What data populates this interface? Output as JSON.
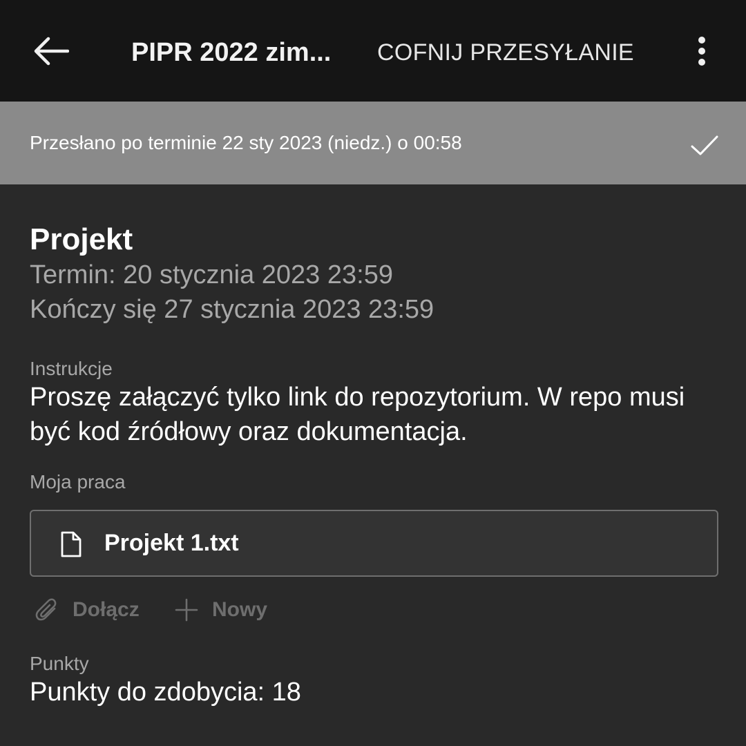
{
  "header": {
    "title": "PIPR 2022 zim...",
    "unsubmit_label": "COFNIJ PRZESYŁANIE",
    "back_icon": "arrow-left-icon",
    "more_icon": "more-vertical-icon"
  },
  "status": {
    "text": "Przesłano po terminie 22 sty 2023 (niedz.) o 00:58",
    "icon": "checkmark-icon"
  },
  "assignment": {
    "title": "Projekt",
    "due": "Termin: 20 stycznia 2023 23:59",
    "closes": "Kończy się 27 stycznia 2023 23:59"
  },
  "instructions": {
    "label": "Instrukcje",
    "text": "Proszę załączyć tylko link do repozytorium. W repo musi być kod źródłowy oraz dokumentacja."
  },
  "my_work": {
    "label": "Moja praca",
    "files": [
      {
        "name": "Projekt 1.txt",
        "icon": "file-icon"
      }
    ],
    "actions": {
      "attach_label": "Dołącz",
      "new_label": "Nowy"
    }
  },
  "points": {
    "label": "Punkty",
    "text": "Punkty do zdobycia: 18"
  },
  "colors": {
    "topbar_bg": "#151515",
    "banner_bg": "#8a8a8a",
    "page_bg": "#292929",
    "muted_text": "#a8a8a8",
    "disabled_action": "#6e6e6e"
  }
}
